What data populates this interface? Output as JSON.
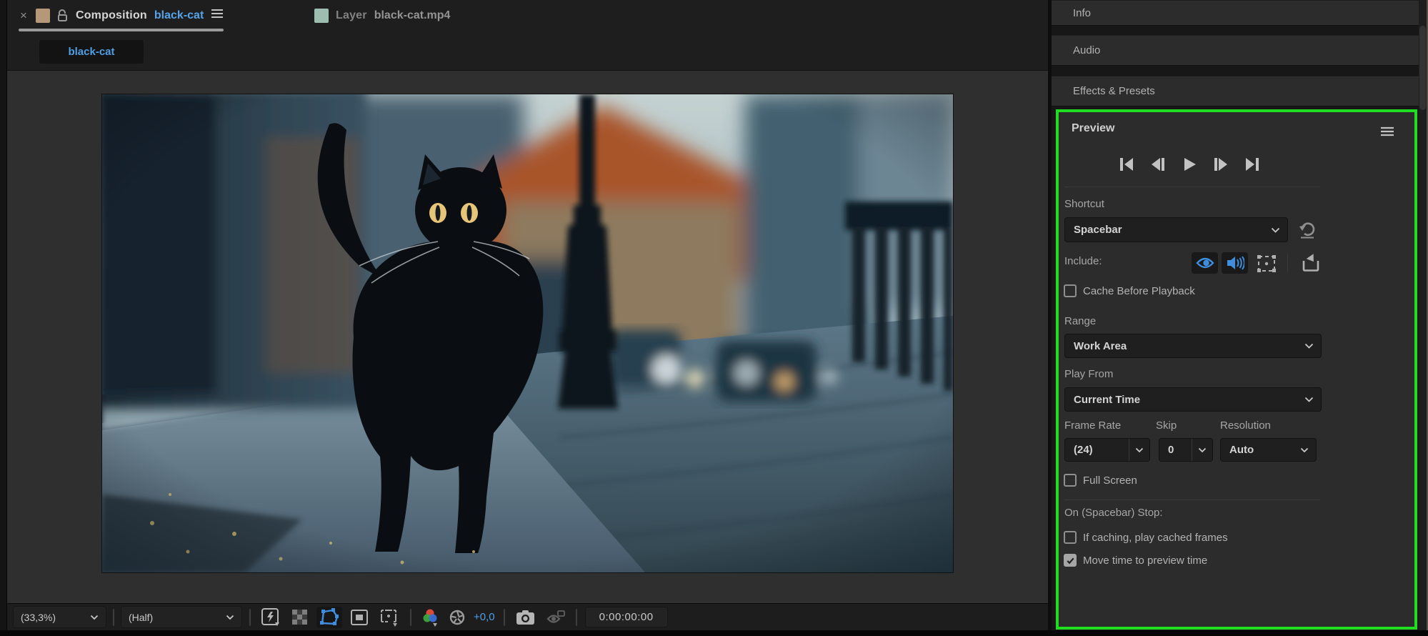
{
  "colors": {
    "accent_blue": "#3f8edd",
    "link_blue": "#55a3e8",
    "highlight_green": "#21dd21",
    "comp_swatch": "#b49877",
    "layer_swatch": "#abcfc2",
    "viewer_bg": "#2f2f2f",
    "panel_bg": "#2c2c2c"
  },
  "composition_panel": {
    "tabs": {
      "close_label": "×",
      "composition": {
        "prefix": "Composition",
        "name": "black-cat",
        "menu_glyph": "≡"
      },
      "layer": {
        "prefix": "Layer",
        "name": "black-cat.mp4"
      }
    },
    "breadcrumb": "black-cat",
    "video_description": "black cat walking toward camera on a blue-toned cobblestone street",
    "toolbar": {
      "magnification": "(33,3%)",
      "resolution": "(Half)",
      "exposure": "+0,0",
      "timecode": "0:00:00:00",
      "icons": [
        "fast-preview",
        "transparency-grid",
        "mask-shape-visibility",
        "region-of-interest",
        "guides-options",
        "show-channels",
        "adjust-exposure",
        "snapshot-camera",
        "show-snapshot"
      ]
    }
  },
  "right_panel": {
    "panels": [
      "Info",
      "Audio",
      "Effects & Presets"
    ],
    "preview": {
      "title": "Preview",
      "menu_glyph": "≡",
      "transport": [
        "first-frame",
        "previous-frame",
        "play",
        "next-frame",
        "last-frame"
      ],
      "shortcut": {
        "label": "Shortcut",
        "value": "Spacebar"
      },
      "include": {
        "label": "Include:",
        "icons": [
          "video-eye",
          "audio-speaker",
          "overlays",
          "send-to-device"
        ]
      },
      "cache": {
        "label": "Cache Before Playback",
        "checked": false
      },
      "range": {
        "label": "Range",
        "value": "Work Area"
      },
      "play_from": {
        "label": "Play From",
        "value": "Current Time"
      },
      "frame_rate": {
        "label": "Frame Rate",
        "value": "(24)"
      },
      "skip": {
        "label": "Skip",
        "value": "0"
      },
      "resolution": {
        "label": "Resolution",
        "value": "Auto"
      },
      "full_screen": {
        "label": "Full Screen",
        "checked": false
      },
      "on_stop": {
        "label": "On (Spacebar) Stop:"
      },
      "if_caching": {
        "label": "If caching, play cached frames",
        "checked": false
      },
      "move_time": {
        "label": "Move time to preview time",
        "checked": true
      }
    }
  }
}
